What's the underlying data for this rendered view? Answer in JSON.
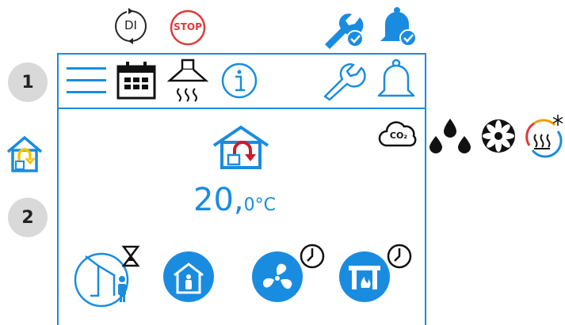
{
  "status_bar": {
    "di_label": "DI",
    "stop_label": "STOP"
  },
  "callouts": {
    "one": "1",
    "two": "2"
  },
  "co2_label": "CO₂",
  "temperature": {
    "value": "20,",
    "unit": "0°C"
  },
  "icons": {
    "status": [
      "di-cycle-icon",
      "stop-icon",
      "wrench-check-icon",
      "bell-check-icon"
    ],
    "toolbar": [
      "menu-icon",
      "calendar-icon",
      "cooker-hood-icon",
      "info-icon",
      "wrench-icon",
      "bell-icon"
    ],
    "indicators": [
      "co2-icon",
      "humidity-icon",
      "fan-icon",
      "heating-cooling-icon"
    ],
    "modes": [
      "away-timer-icon",
      "home-icon",
      "boost-fan-timer-icon",
      "fireplace-timer-icon"
    ]
  },
  "colors": {
    "accent": "#1a8ce0",
    "stop_red": "#e03a3a",
    "return_red": "#cc1c2b",
    "home_yellow": "#f2c500",
    "callout_gray": "#d9d9d9"
  }
}
